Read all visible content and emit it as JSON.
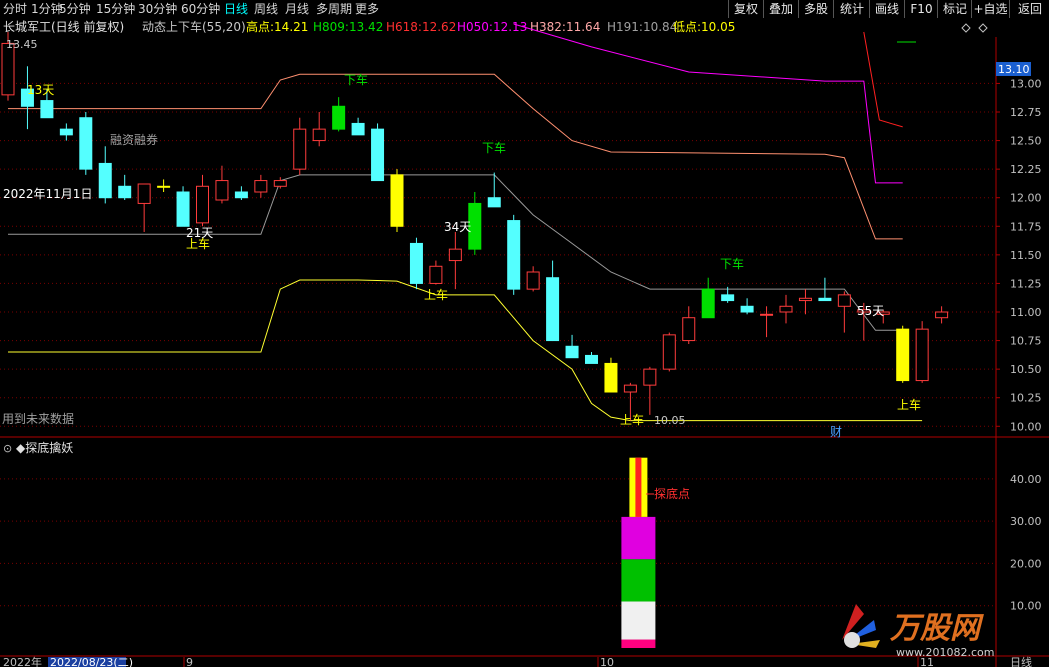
{
  "toolbar": {
    "tabs": [
      {
        "label": "分时"
      },
      {
        "label": "1分钟"
      },
      {
        "label": "5分钟"
      },
      {
        "label": "15分钟"
      },
      {
        "label": "30分钟"
      },
      {
        "label": "60分钟"
      },
      {
        "label": "日线",
        "active": true
      },
      {
        "label": "周线"
      },
      {
        "label": "月线"
      },
      {
        "label": "多周期"
      },
      {
        "label": "更多"
      }
    ],
    "right_buttons": [
      {
        "label": "复权"
      },
      {
        "label": "叠加"
      },
      {
        "label": "多股"
      },
      {
        "label": "统计"
      },
      {
        "label": "画线"
      },
      {
        "label": "F10"
      },
      {
        "label": "标记"
      },
      {
        "label": "+自选"
      },
      {
        "label": "返回"
      }
    ]
  },
  "title": {
    "stock": "长城军工(日线 前复权)",
    "indicator": "动态上下车(55,20)",
    "items": [
      {
        "label": "高点:",
        "value": "14.21",
        "color": "#ffff00"
      },
      {
        "label": "H809:",
        "value": "13.42",
        "color": "#00e000"
      },
      {
        "label": "H618:",
        "value": "12.62",
        "color": "#ff3030"
      },
      {
        "label": "H050:",
        "value": "12.13",
        "color": "#ff00ff"
      },
      {
        "label": "H382:",
        "value": "11.64",
        "color": "#ffa8a8"
      },
      {
        "label": "H191:",
        "value": "10.84",
        "color": "#a0a0a0"
      },
      {
        "label": "低点:",
        "value": "10.05",
        "color": "#ffff00"
      }
    ]
  },
  "main_labels": {
    "high_marker": "13.45",
    "low_marker": "10.05",
    "finance": "融资融券",
    "date_note": "2022年11月1日",
    "future_warning": "用到未来数据",
    "cai": "财",
    "current_price": "13.10"
  },
  "annotations": [
    {
      "text": "13天",
      "color": "#ffff00"
    },
    {
      "text": "下车",
      "color": "#00e000"
    },
    {
      "text": "下车",
      "color": "#00e000"
    },
    {
      "text": "21天",
      "color": "#ffffff"
    },
    {
      "text": "上车",
      "color": "#ffff00"
    },
    {
      "text": "34天",
      "color": "#ffffff"
    },
    {
      "text": "上车",
      "color": "#ffff00"
    },
    {
      "text": "下车",
      "color": "#00e000"
    },
    {
      "text": "55天",
      "color": "#ffffff"
    },
    {
      "text": "上车",
      "color": "#ffff00"
    },
    {
      "text": "上车",
      "color": "#ffff00"
    }
  ],
  "sub_panel": {
    "title": "◆探底擒妖",
    "signal_label": "探底点",
    "ylabels": [
      "40.00",
      "30.00",
      "20.00",
      "10.00"
    ]
  },
  "price_axis": [
    "13.00",
    "12.75",
    "12.50",
    "12.25",
    "12.00",
    "11.75",
    "11.50",
    "11.25",
    "11.00",
    "10.75",
    "10.50",
    "10.25",
    "10.00"
  ],
  "date_axis": [
    {
      "label": "2022年"
    },
    {
      "label": "2022/08/23(二)",
      "highlight": true
    },
    {
      "label": "9"
    },
    {
      "label": "10"
    },
    {
      "label": "11"
    },
    {
      "label": "日线"
    }
  ],
  "watermark": {
    "brand": "万股网",
    "url": "www.201082.com"
  },
  "colors": {
    "up": "#ff3c3c",
    "down": "#54ffff",
    "line_yellow": "#ffff30",
    "line_gray": "#9a9a9a",
    "line_salmon": "#ff9070",
    "line_magenta": "#ff00ff",
    "line_red": "#ff2020",
    "grid": "#7a0000"
  },
  "chart_data": {
    "type": "candlestick",
    "ylim": [
      9.95,
      13.45
    ],
    "candles": [
      {
        "o": 12.9,
        "h": 13.45,
        "l": 12.85,
        "c": 13.35
      },
      {
        "o": 12.95,
        "h": 13.15,
        "l": 12.6,
        "c": 12.8
      },
      {
        "o": 12.85,
        "h": 12.95,
        "l": 12.7,
        "c": 12.7
      },
      {
        "o": 12.6,
        "h": 12.65,
        "l": 12.5,
        "c": 12.55
      },
      {
        "o": 12.7,
        "h": 12.75,
        "l": 12.2,
        "c": 12.25
      },
      {
        "o": 12.3,
        "h": 12.45,
        "l": 11.95,
        "c": 12.0
      },
      {
        "o": 12.1,
        "h": 12.2,
        "l": 11.98,
        "c": 12.0
      },
      {
        "o": 11.95,
        "h": 12.1,
        "l": 11.7,
        "c": 12.12
      },
      {
        "o": 12.1,
        "h": 12.16,
        "l": 12.05,
        "c": 12.1
      },
      {
        "o": 12.05,
        "h": 12.1,
        "l": 11.75,
        "c": 11.75
      },
      {
        "o": 11.78,
        "h": 12.2,
        "l": 11.75,
        "c": 12.1
      },
      {
        "o": 11.98,
        "h": 12.28,
        "l": 11.95,
        "c": 12.15
      },
      {
        "o": 12.05,
        "h": 12.1,
        "l": 11.98,
        "c": 12.0
      },
      {
        "o": 12.05,
        "h": 12.2,
        "l": 12.0,
        "c": 12.15
      },
      {
        "o": 12.1,
        "h": 12.18,
        "l": 12.08,
        "c": 12.15
      },
      {
        "o": 12.25,
        "h": 12.7,
        "l": 12.2,
        "c": 12.6
      },
      {
        "o": 12.5,
        "h": 12.75,
        "l": 12.45,
        "c": 12.6
      },
      {
        "o": 12.6,
        "h": 12.88,
        "l": 12.58,
        "c": 12.8
      },
      {
        "o": 12.65,
        "h": 12.7,
        "l": 12.55,
        "c": 12.55
      },
      {
        "o": 12.6,
        "h": 12.65,
        "l": 12.15,
        "c": 12.15
      },
      {
        "o": 12.2,
        "h": 12.25,
        "l": 11.7,
        "c": 11.75
      },
      {
        "o": 11.6,
        "h": 11.65,
        "l": 11.2,
        "c": 11.25
      },
      {
        "o": 11.25,
        "h": 11.45,
        "l": 11.24,
        "c": 11.4
      },
      {
        "o": 11.45,
        "h": 11.7,
        "l": 11.2,
        "c": 11.55
      },
      {
        "o": 11.55,
        "h": 12.05,
        "l": 11.5,
        "c": 11.95
      },
      {
        "o": 12.0,
        "h": 12.22,
        "l": 11.95,
        "c": 11.92
      },
      {
        "o": 11.8,
        "h": 11.85,
        "l": 11.15,
        "c": 11.2
      },
      {
        "o": 11.2,
        "h": 11.4,
        "l": 11.18,
        "c": 11.35
      },
      {
        "o": 11.3,
        "h": 11.45,
        "l": 10.75,
        "c": 10.75
      },
      {
        "o": 10.7,
        "h": 10.8,
        "l": 10.6,
        "c": 10.6
      },
      {
        "o": 10.62,
        "h": 10.65,
        "l": 10.55,
        "c": 10.55
      },
      {
        "o": 10.55,
        "h": 10.6,
        "l": 10.3,
        "c": 10.3
      },
      {
        "o": 10.3,
        "h": 10.38,
        "l": 10.05,
        "c": 10.36
      },
      {
        "o": 10.36,
        "h": 10.52,
        "l": 10.1,
        "c": 10.5
      },
      {
        "o": 10.5,
        "h": 10.82,
        "l": 10.48,
        "c": 10.8
      },
      {
        "o": 10.75,
        "h": 11.05,
        "l": 10.72,
        "c": 10.95
      },
      {
        "o": 10.95,
        "h": 11.3,
        "l": 10.95,
        "c": 11.2
      },
      {
        "o": 11.15,
        "h": 11.22,
        "l": 11.08,
        "c": 11.1
      },
      {
        "o": 11.05,
        "h": 11.12,
        "l": 10.98,
        "c": 11.0
      },
      {
        "o": 10.98,
        "h": 11.05,
        "l": 10.78,
        "c": 10.98
      },
      {
        "o": 11.0,
        "h": 11.15,
        "l": 10.9,
        "c": 11.05
      },
      {
        "o": 11.1,
        "h": 11.2,
        "l": 10.98,
        "c": 11.12
      },
      {
        "o": 11.12,
        "h": 11.3,
        "l": 11.1,
        "c": 11.1
      },
      {
        "o": 11.05,
        "h": 11.18,
        "l": 10.82,
        "c": 11.15
      },
      {
        "o": 11.0,
        "h": 11.08,
        "l": 10.75,
        "c": 11.02
      },
      {
        "o": 10.98,
        "h": 11.02,
        "l": 10.9,
        "c": 11.0
      },
      {
        "o": 10.85,
        "h": 10.88,
        "l": 10.38,
        "c": 10.4
      },
      {
        "o": 10.4,
        "h": 10.92,
        "l": 10.38,
        "c": 10.85
      },
      {
        "o": 10.95,
        "h": 11.05,
        "l": 10.9,
        "c": 11.0
      }
    ],
    "highlight": [
      {
        "index": 8,
        "color": "#ffff00"
      },
      {
        "index": 20,
        "color": "#ffff00"
      },
      {
        "index": 17,
        "color": "#00e000"
      },
      {
        "index": 24,
        "color": "#00e000"
      },
      {
        "index": 31,
        "color": "#ffff00"
      },
      {
        "index": 36,
        "color": "#00e000"
      },
      {
        "index": 46,
        "color": "#ffff00"
      }
    ],
    "lines": [
      {
        "name": "H050",
        "color": "#ff00ff",
        "points": [
          [
            26,
            13.52
          ],
          [
            30,
            13.32
          ],
          [
            35,
            13.1
          ],
          [
            42,
            13.02
          ],
          [
            44,
            13.02
          ],
          [
            44.6,
            12.13
          ],
          [
            46,
            12.13
          ]
        ]
      },
      {
        "name": "H618",
        "color": "#ff2020",
        "points": [
          [
            44,
            13.45
          ],
          [
            44.8,
            12.68
          ],
          [
            46,
            12.62
          ]
        ]
      },
      {
        "name": "H382",
        "color": "#ff9070",
        "points": [
          [
            0,
            12.78
          ],
          [
            13,
            12.78
          ],
          [
            14,
            13.03
          ],
          [
            15,
            13.08
          ],
          [
            25,
            13.08
          ],
          [
            27,
            12.78
          ],
          [
            29,
            12.5
          ],
          [
            31,
            12.4
          ],
          [
            42,
            12.38
          ],
          [
            43,
            12.35
          ],
          [
            44.6,
            11.64
          ],
          [
            46,
            11.64
          ]
        ]
      },
      {
        "name": "H191",
        "color": "#9a9a9a",
        "points": [
          [
            0,
            11.68
          ],
          [
            13,
            11.68
          ],
          [
            14,
            12.15
          ],
          [
            15,
            12.2
          ],
          [
            25,
            12.2
          ],
          [
            27,
            11.85
          ],
          [
            29,
            11.6
          ],
          [
            31,
            11.35
          ],
          [
            33,
            11.2
          ],
          [
            43,
            11.2
          ],
          [
            44.6,
            10.84
          ],
          [
            46,
            10.84
          ]
        ]
      },
      {
        "name": "low",
        "color": "#ffff30",
        "points": [
          [
            0,
            10.65
          ],
          [
            13,
            10.65
          ],
          [
            14,
            11.2
          ],
          [
            15,
            11.28
          ],
          [
            18,
            11.28
          ],
          [
            20,
            11.27
          ],
          [
            22,
            11.15
          ],
          [
            25,
            11.15
          ],
          [
            27,
            10.75
          ],
          [
            29,
            10.5
          ],
          [
            30,
            10.2
          ],
          [
            31,
            10.08
          ],
          [
            32,
            10.05
          ],
          [
            47,
            10.05
          ]
        ]
      }
    ],
    "sub_bars": [
      {
        "index": 32,
        "segments": [
          {
            "from": 0,
            "to": 2,
            "color": "#ff0080"
          },
          {
            "from": 2,
            "to": 11,
            "color": "#f0f0f0"
          },
          {
            "from": 11,
            "to": 21,
            "color": "#00c000"
          },
          {
            "from": 21,
            "to": 31,
            "color": "#e000e0"
          },
          {
            "from": 31,
            "to": 45,
            "color": "#ffff00"
          }
        ]
      }
    ]
  }
}
